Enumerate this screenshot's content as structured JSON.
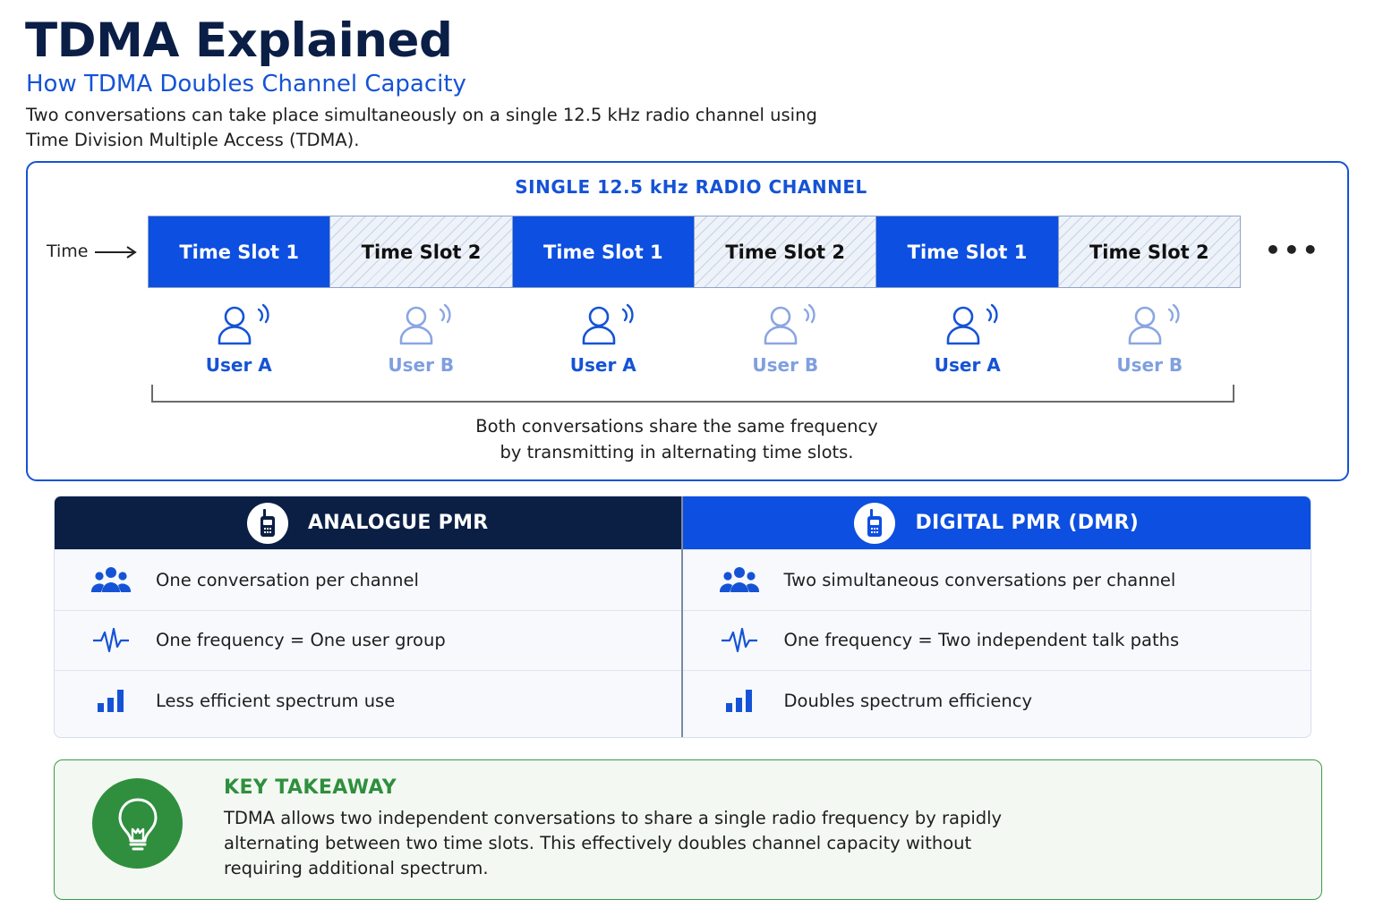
{
  "header": {
    "title": "TDMA Explained",
    "subtitle": "How TDMA Doubles Channel Capacity",
    "intro": "Two conversations can take place simultaneously on a single 12.5 kHz radio channel using Time Division Multiple Access (TDMA)."
  },
  "channel": {
    "heading": "SINGLE 12.5 kHz RADIO CHANNEL",
    "time_label": "Time",
    "slots": [
      "Time Slot 1",
      "Time Slot 2",
      "Time Slot 1",
      "Time Slot 2",
      "Time Slot 1",
      "Time Slot 2"
    ],
    "users": [
      "User A",
      "User B",
      "User A",
      "User B",
      "User A",
      "User B"
    ],
    "continuation": "•••",
    "shared_line1": "Both conversations share the same frequency",
    "shared_line2": "by transmitting in alternating time slots."
  },
  "comparison": {
    "analogue": {
      "title": "ANALOGUE PMR",
      "rows": [
        "One conversation per channel",
        "One frequency = One user group",
        "Less efficient spectrum use"
      ]
    },
    "digital": {
      "title": "DIGITAL PMR (DMR)",
      "rows": [
        "Two simultaneous conversations per channel",
        "One frequency = Two independent talk paths",
        "Doubles spectrum efficiency"
      ]
    },
    "row_icons": [
      "users-group-icon",
      "waveform-icon",
      "bar-chart-icon"
    ]
  },
  "takeaway": {
    "title": "KEY TAKEAWAY",
    "body": "TDMA allows two independent conversations to share a single radio frequency by rapidly alternating between two time slots.  This effectively doubles channel capacity without requiring additional spectrum."
  },
  "colors": {
    "navy": "#0b1e46",
    "blue": "#1553d6",
    "slot_blue": "#0d4fe0",
    "user_b": "#7f9fe0",
    "green": "#2f8f3e"
  }
}
